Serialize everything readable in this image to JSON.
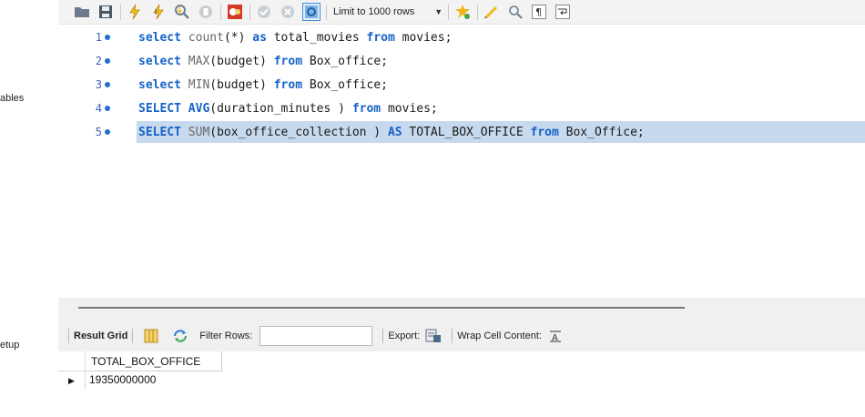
{
  "sidebar": {
    "labels": [
      "ables",
      "etup"
    ]
  },
  "toolbar": {
    "icons": [
      "open-folder-icon",
      "save-icon",
      "execute-icon",
      "execute-current-icon",
      "explain-icon",
      "stop-icon",
      "toggle-error-icon",
      "commit-icon",
      "rollback-icon",
      "autocommit-icon",
      "bookmark-icon",
      "beautify-icon",
      "find-icon",
      "invisible-chars-icon",
      "wrap-icon"
    ],
    "limit_label": "Limit to 1000 rows"
  },
  "editor": {
    "lines": [
      {
        "number": "1",
        "tokens": [
          {
            "t": "select",
            "k": "kw"
          },
          {
            "t": " ",
            "k": ""
          },
          {
            "t": "count",
            "k": "fn"
          },
          {
            "t": "(*) ",
            "k": ""
          },
          {
            "t": "as",
            "k": "kw"
          },
          {
            "t": " total_movies ",
            "k": ""
          },
          {
            "t": "from",
            "k": "kw"
          },
          {
            "t": " movies;",
            "k": ""
          }
        ]
      },
      {
        "number": "2",
        "tokens": [
          {
            "t": "select",
            "k": "kw"
          },
          {
            "t": " ",
            "k": ""
          },
          {
            "t": "MAX",
            "k": "fn"
          },
          {
            "t": "(budget) ",
            "k": ""
          },
          {
            "t": "from",
            "k": "kw"
          },
          {
            "t": " Box_office;",
            "k": ""
          }
        ]
      },
      {
        "number": "3",
        "tokens": [
          {
            "t": "select",
            "k": "kw"
          },
          {
            "t": " ",
            "k": ""
          },
          {
            "t": "MIN",
            "k": "fn"
          },
          {
            "t": "(budget) ",
            "k": ""
          },
          {
            "t": "from",
            "k": "kw"
          },
          {
            "t": " Box_office;",
            "k": ""
          }
        ]
      },
      {
        "number": "4",
        "tokens": [
          {
            "t": "SELECT",
            "k": "kw"
          },
          {
            "t": " ",
            "k": ""
          },
          {
            "t": "AVG",
            "k": "kw"
          },
          {
            "t": "(duration_minutes ) ",
            "k": ""
          },
          {
            "t": "from",
            "k": "kw"
          },
          {
            "t": " movies;",
            "k": ""
          }
        ]
      },
      {
        "number": "5",
        "selected": true,
        "tokens": [
          {
            "t": "SELECT",
            "k": "kw"
          },
          {
            "t": " ",
            "k": ""
          },
          {
            "t": "SUM",
            "k": "fn"
          },
          {
            "t": "(box_office_collection ) ",
            "k": ""
          },
          {
            "t": "AS",
            "k": "kw"
          },
          {
            "t": " TOTAL_BOX_OFFICE ",
            "k": ""
          },
          {
            "t": "from",
            "k": "kw"
          },
          {
            "t": " Box_Office;",
            "k": ""
          }
        ]
      }
    ]
  },
  "result_toolbar": {
    "result_grid_label": "Result Grid",
    "filter_label": "Filter Rows:",
    "filter_value": "",
    "export_label": "Export:",
    "wrap_label": "Wrap Cell Content:"
  },
  "grid": {
    "columns": [
      "TOTAL_BOX_OFFICE"
    ],
    "rows": [
      [
        "19350000000"
      ]
    ]
  },
  "colors": {
    "keyword": "#1663c8",
    "selection": "#c7d9ee",
    "line_number": "#3a62b5"
  }
}
